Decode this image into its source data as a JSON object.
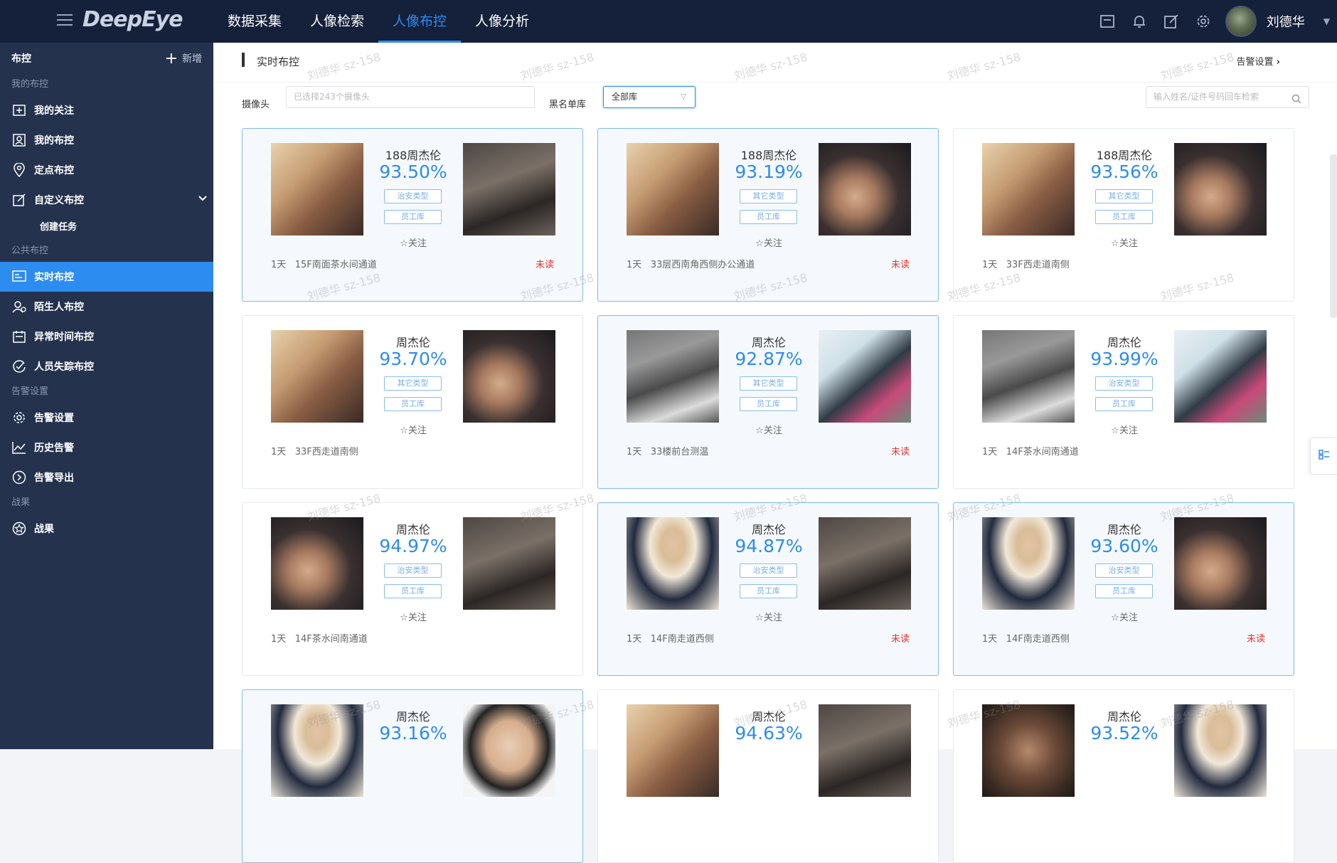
{
  "app": {
    "logo": "DeepEye"
  },
  "nav": [
    {
      "label": "数据采集",
      "active": false
    },
    {
      "label": "人像检索",
      "active": false
    },
    {
      "label": "人像布控",
      "active": true
    },
    {
      "label": "人像分析",
      "active": false
    }
  ],
  "user": {
    "name": "刘德华"
  },
  "sidebar": {
    "title": "布控",
    "add_label": "新增",
    "groups": {
      "mine": "我的布控",
      "public": "公共布控",
      "alarm": "告警设置",
      "result": "战果"
    },
    "items": {
      "follow": "我的关注",
      "mycontrol": "我的布控",
      "fixed": "定点布控",
      "custom": "自定义布控",
      "create": "创建任务",
      "realtime": "实时布控",
      "stranger": "陌生人布控",
      "abnormal": "异常时间布控",
      "missing": "人员失踪布控",
      "alarmset": "告警设置",
      "history": "历史告警",
      "export": "告警导出",
      "result": "战果"
    }
  },
  "main": {
    "title": "实时布控",
    "alarm_link": "告警设置",
    "filters": {
      "camera_label": "摄像头",
      "camera_placeholder": "已选择243个摄像头",
      "blacklist_label": "黑名单库",
      "blacklist_value": "全部库",
      "search_placeholder": "输入姓名/证件号码回车检索"
    }
  },
  "cards": [
    {
      "name": "188周杰伦",
      "score": "93.50%",
      "tag1": "治安类型",
      "tag2": "员工库",
      "follow": "☆关注",
      "time": "1天",
      "location": "15F南面茶水间通道",
      "status": "未读"
    },
    {
      "name": "188周杰伦",
      "score": "93.19%",
      "tag1": "其它类型",
      "tag2": "员工库",
      "follow": "☆关注",
      "time": "1天",
      "location": "33层西南角西侧办公通道",
      "status": "未读"
    },
    {
      "name": "188周杰伦",
      "score": "93.56%",
      "tag1": "其它类型",
      "tag2": "员工库",
      "follow": "☆关注",
      "time": "1天",
      "location": "33F西走道南侧",
      "status": ""
    },
    {
      "name": "周杰伦",
      "score": "93.70%",
      "tag1": "其它类型",
      "tag2": "员工库",
      "follow": "☆关注",
      "time": "1天",
      "location": "33F西走道南侧",
      "status": ""
    },
    {
      "name": "周杰伦",
      "score": "92.87%",
      "tag1": "其它类型",
      "tag2": "员工库",
      "follow": "☆关注",
      "time": "1天",
      "location": "33楼前台测温",
      "status": "未读"
    },
    {
      "name": "周杰伦",
      "score": "93.99%",
      "tag1": "治安类型",
      "tag2": "员工库",
      "follow": "☆关注",
      "time": "1天",
      "location": "14F茶水间南通道",
      "status": ""
    },
    {
      "name": "周杰伦",
      "score": "94.97%",
      "tag1": "治安类型",
      "tag2": "员工库",
      "follow": "☆关注",
      "time": "1天",
      "location": "14F茶水间南通道",
      "status": ""
    },
    {
      "name": "周杰伦",
      "score": "94.87%",
      "tag1": "治安类型",
      "tag2": "员工库",
      "follow": "☆关注",
      "time": "1天",
      "location": "14F南走道西侧",
      "status": "未读"
    },
    {
      "name": "周杰伦",
      "score": "93.60%",
      "tag1": "治安类型",
      "tag2": "员工库",
      "follow": "☆关注",
      "time": "1天",
      "location": "14F南走道西侧",
      "status": "未读"
    },
    {
      "name": "周杰伦",
      "score": "93.16%"
    },
    {
      "name": "周杰伦",
      "score": "94.63%"
    },
    {
      "name": "周杰伦",
      "score": "93.52%"
    }
  ],
  "watermark": "刘德华 sz-158"
}
